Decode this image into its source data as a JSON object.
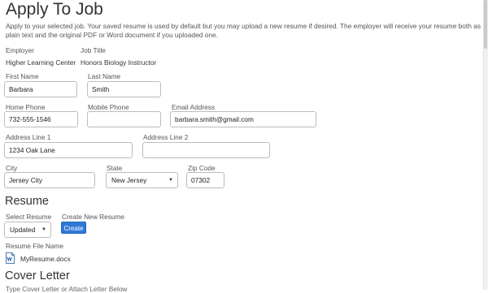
{
  "page": {
    "title": "Apply To Job",
    "intro": "Apply to your selected job. Your saved resume is used by default but you may upload a new resume if desired. The employer will receive your resume both as plain text and the original PDF or Word document if you uploaded one."
  },
  "job": {
    "employer_label": "Employer",
    "employer_value": "Higher Learning Center",
    "job_title_label": "Job Title",
    "job_title_value": "Honors Biology Instructor"
  },
  "form": {
    "first_name": {
      "label": "First Name",
      "value": "Barbara"
    },
    "last_name": {
      "label": "Last Name",
      "value": "Smith"
    },
    "home_phone": {
      "label": "Home Phone",
      "value": "732-555-1546"
    },
    "mobile_phone": {
      "label": "Mobile Phone",
      "value": ""
    },
    "email": {
      "label": "Email Address",
      "value": "barbara.smith@gmail.com"
    },
    "address1": {
      "label": "Address Line 1",
      "value": "1234 Oak Lane"
    },
    "address2": {
      "label": "Address Line 2",
      "value": ""
    },
    "city": {
      "label": "City",
      "value": "Jersey City"
    },
    "state": {
      "label": "State",
      "value": "New Jersey"
    },
    "zip": {
      "label": "Zip Code",
      "value": "07302"
    }
  },
  "resume": {
    "heading": "Resume",
    "select_label": "Select Resume",
    "select_value": "Updated",
    "create_label": "Create New Resume",
    "create_button": "Create",
    "file_label": "Resume File Name",
    "file_name": "MyResume.docx",
    "file_icon": "word-document-icon"
  },
  "cover_letter": {
    "heading": "Cover Letter",
    "cut_text": "Type Cover Letter or Attach Letter Below"
  },
  "colors": {
    "accent": "#2f79d6",
    "border": "#bcbcbc",
    "text": "#333333"
  }
}
